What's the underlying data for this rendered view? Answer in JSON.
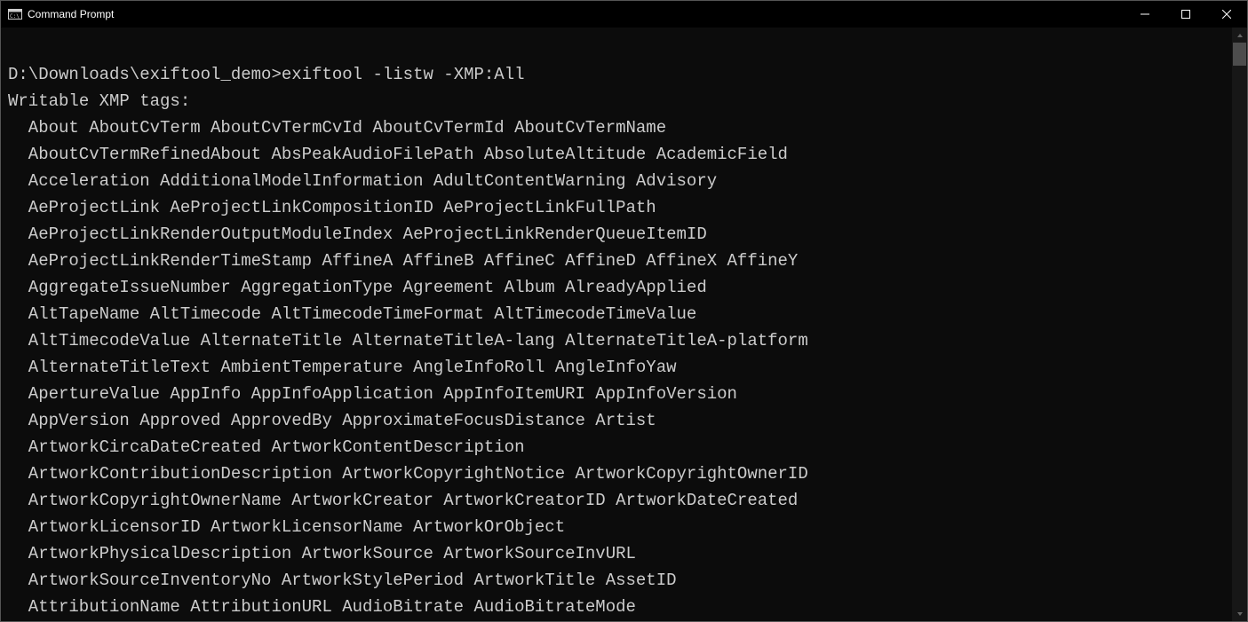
{
  "window": {
    "title": "Command Prompt"
  },
  "terminal": {
    "prompt": "D:\\Downloads\\exiftool_demo>",
    "command": "exiftool -listw -XMP:All",
    "header": "Writable XMP tags:",
    "lines": [
      "About AboutCvTerm AboutCvTermCvId AboutCvTermId AboutCvTermName",
      "AboutCvTermRefinedAbout AbsPeakAudioFilePath AbsoluteAltitude AcademicField",
      "Acceleration AdditionalModelInformation AdultContentWarning Advisory",
      "AeProjectLink AeProjectLinkCompositionID AeProjectLinkFullPath",
      "AeProjectLinkRenderOutputModuleIndex AeProjectLinkRenderQueueItemID",
      "AeProjectLinkRenderTimeStamp AffineA AffineB AffineC AffineD AffineX AffineY",
      "AggregateIssueNumber AggregationType Agreement Album AlreadyApplied",
      "AltTapeName AltTimecode AltTimecodeTimeFormat AltTimecodeTimeValue",
      "AltTimecodeValue AlternateTitle AlternateTitleA-lang AlternateTitleA-platform",
      "AlternateTitleText AmbientTemperature AngleInfoRoll AngleInfoYaw",
      "ApertureValue AppInfo AppInfoApplication AppInfoItemURI AppInfoVersion",
      "AppVersion Approved ApprovedBy ApproximateFocusDistance Artist",
      "ArtworkCircaDateCreated ArtworkContentDescription",
      "ArtworkContributionDescription ArtworkCopyrightNotice ArtworkCopyrightOwnerID",
      "ArtworkCopyrightOwnerName ArtworkCreator ArtworkCreatorID ArtworkDateCreated",
      "ArtworkLicensorID ArtworkLicensorName ArtworkOrObject",
      "ArtworkPhysicalDescription ArtworkSource ArtworkSourceInvURL",
      "ArtworkSourceInventoryNo ArtworkStylePeriod ArtworkTitle AssetID",
      "AttributionName AttributionURL AudioBitrate AudioBitrateMode"
    ]
  }
}
